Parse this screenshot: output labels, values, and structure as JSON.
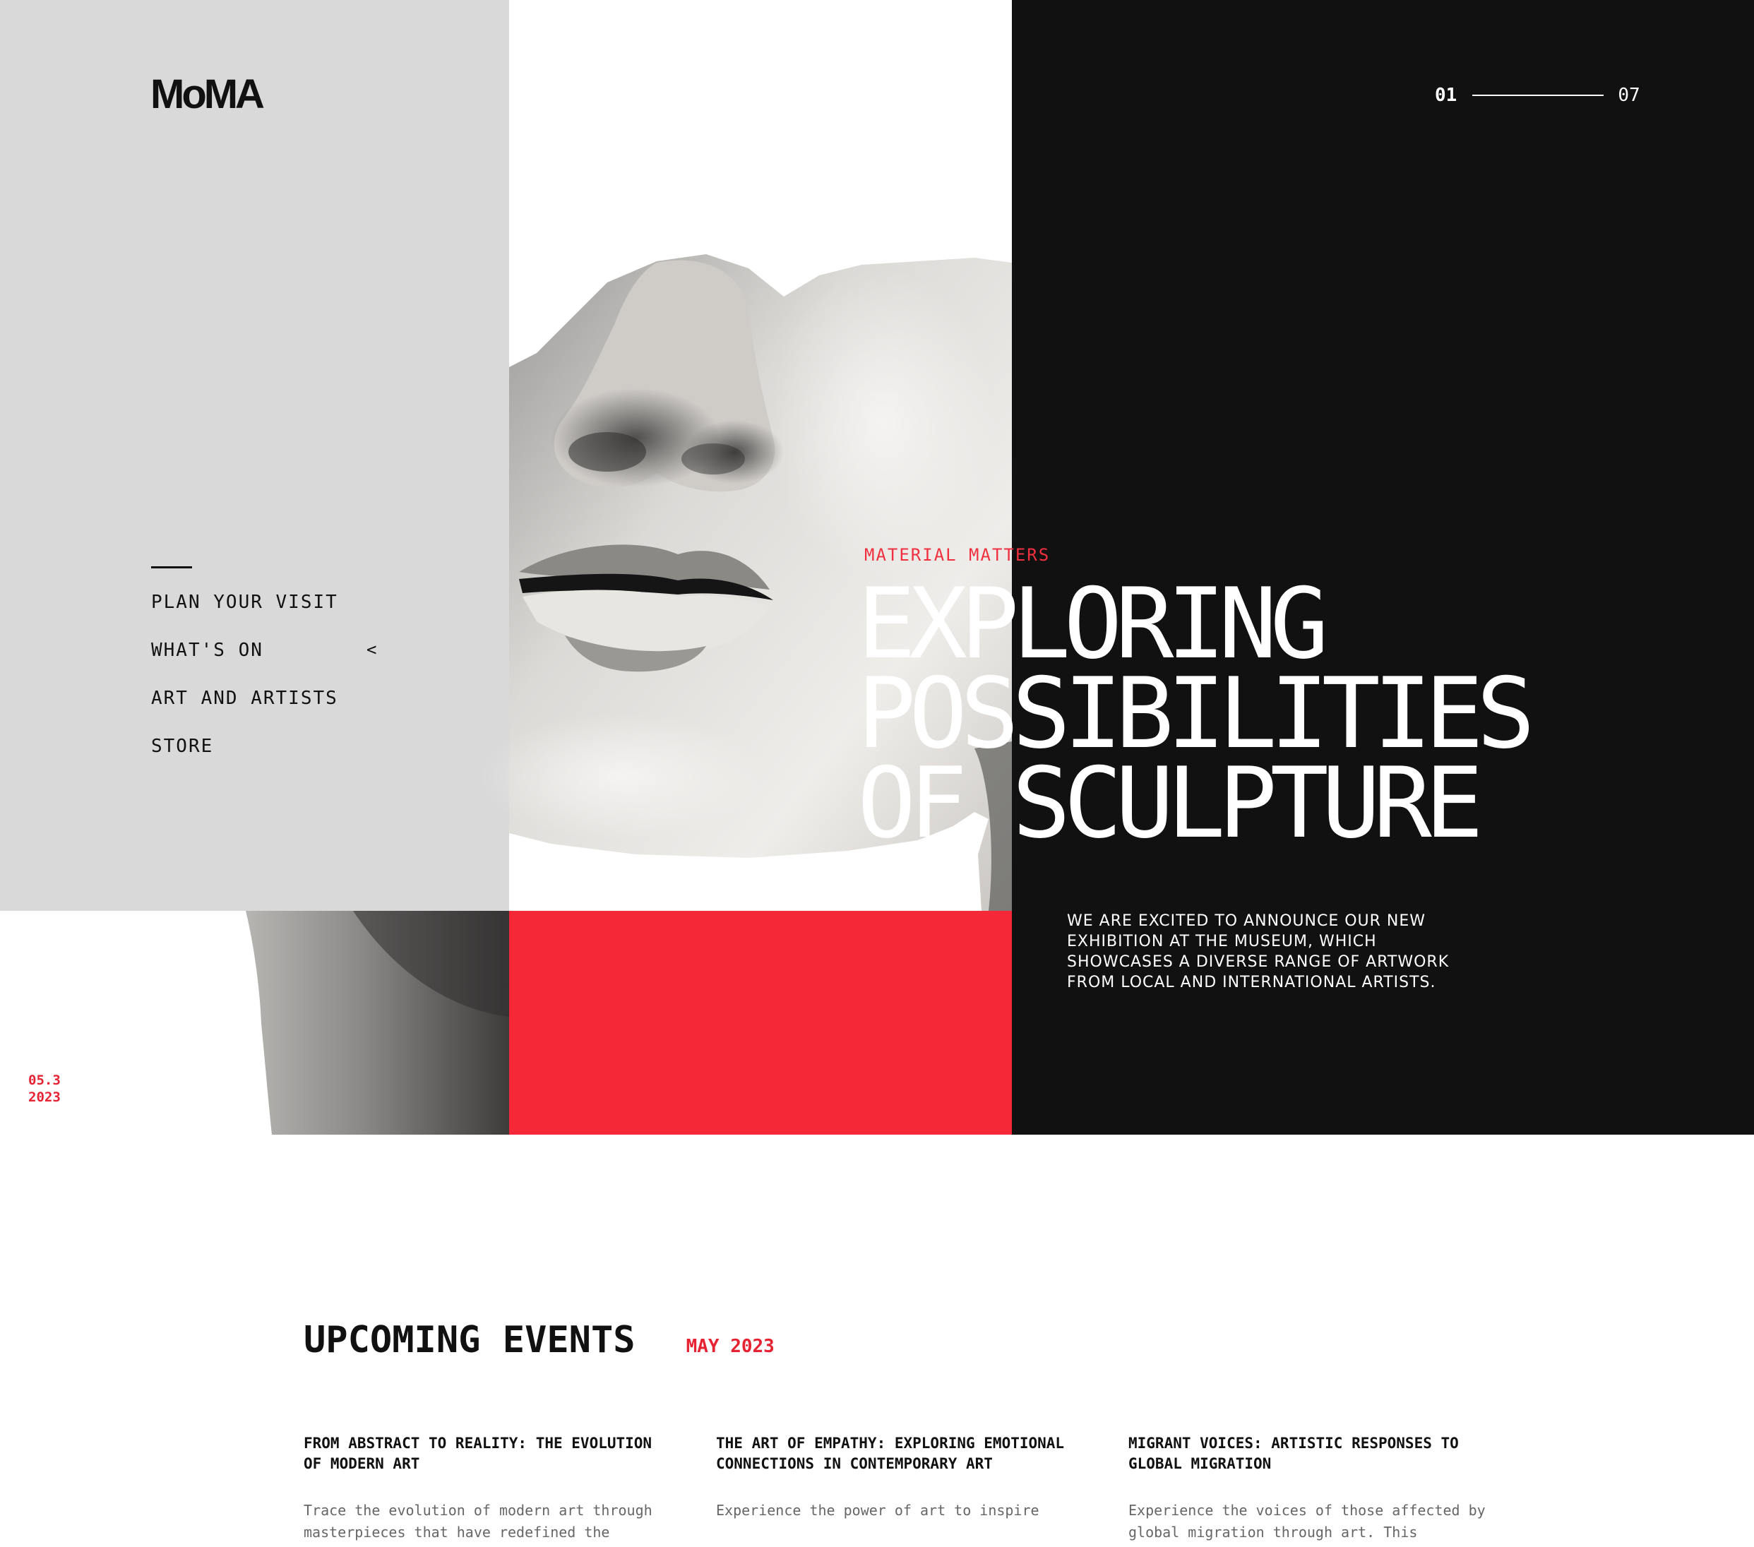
{
  "brand": {
    "logo_text": "MoMA"
  },
  "slider": {
    "current": "01",
    "total": "07"
  },
  "nav": {
    "items": [
      {
        "label": "PLAN YOUR VISIT"
      },
      {
        "label": "WHAT'S ON",
        "indicator": "<"
      },
      {
        "label": "ART AND ARTISTS"
      },
      {
        "label": "STORE"
      }
    ]
  },
  "hero": {
    "date_line1": "05.3",
    "date_line2": "2023",
    "kicker": "MATERIAL MATTERS",
    "headline": [
      "EXPLORING",
      "POSSIBILITIES",
      "OF SCULPTURE"
    ],
    "intro": "WE ARE EXCITED TO ANNOUNCE OUR NEW EXHIBITION AT THE MUSEUM, WHICH SHOWCASES A DIVERSE RANGE OF ARTWORK FROM LOCAL AND INTERNATIONAL ARTISTS."
  },
  "events": {
    "title": "UPCOMING EVENTS",
    "month": "MAY 2023",
    "items": [
      {
        "title": "FROM ABSTRACT TO REALITY: THE EVOLUTION OF MODERN ART",
        "description": "Trace the evolution of modern art through masterpieces that have redefined the"
      },
      {
        "title": "THE ART OF EMPATHY: EXPLORING EMOTIONAL CONNECTIONS IN CONTEMPORARY ART",
        "description": "Experience the power of art to inspire"
      },
      {
        "title": "MIGRANT VOICES: ARTISTIC RESPONSES TO GLOBAL MIGRATION",
        "description": "Experience the voices of those affected by global migration through art. This"
      }
    ]
  },
  "colors": {
    "accent_red": "#f52837",
    "panel_grey": "#d9d9d9",
    "panel_black": "#111111"
  },
  "icons": {
    "caret": "chevron-left-icon",
    "hero_image": "sculpture-face-image"
  }
}
